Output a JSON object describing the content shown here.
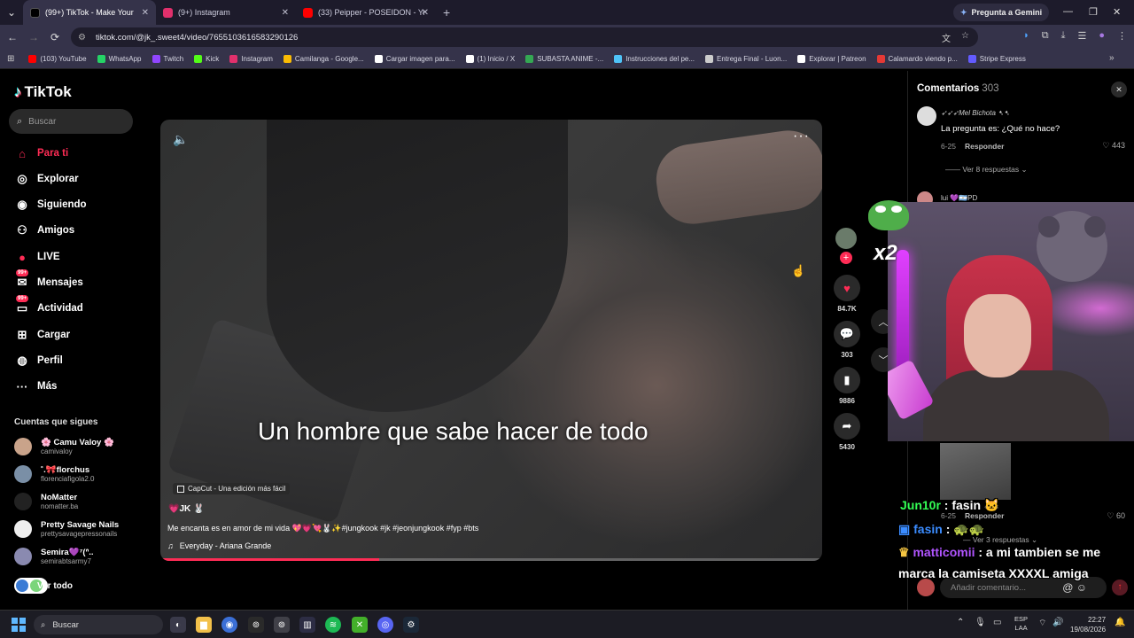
{
  "browser": {
    "tabs": [
      {
        "title": "(99+) TikTok - Make Your Day",
        "active": true,
        "favicon_color": "#000000"
      },
      {
        "title": "(9+) Instagram",
        "active": false,
        "favicon_color": "#e1306c"
      },
      {
        "title": "(33) Peipper - POSEIDON - YouTube",
        "active": false,
        "favicon_color": "#ff0000"
      }
    ],
    "gemini_label": "Pregunta a Gemini",
    "url": "tiktok.com/@jk_.sweet4/video/7655103616583290126",
    "bookmarks": [
      {
        "label": "(103) YouTube",
        "color": "#ff0000"
      },
      {
        "label": "WhatsApp",
        "color": "#25d366"
      },
      {
        "label": "Twitch",
        "color": "#9146ff"
      },
      {
        "label": "Kick",
        "color": "#53fc18"
      },
      {
        "label": "Instagram",
        "color": "#e1306c"
      },
      {
        "label": "Camilanga - Google...",
        "color": "#fbbc04"
      },
      {
        "label": "Cargar imagen para...",
        "color": "#ffffff"
      },
      {
        "label": "(1) Inicio / X",
        "color": "#ffffff"
      },
      {
        "label": "SUBASTA ANIME -...",
        "color": "#34a853"
      },
      {
        "label": "Instrucciones del pe...",
        "color": "#4fc3f7"
      },
      {
        "label": "Entrega Final - Luon...",
        "color": "#cccccc"
      },
      {
        "label": "Explorar | Patreon",
        "color": "#ffffff"
      },
      {
        "label": "Calamardo viendo p...",
        "color": "#e53935"
      },
      {
        "label": "Stripe Express",
        "color": "#635bff"
      }
    ]
  },
  "tiktok": {
    "logo_text": "TikTok",
    "search_placeholder": "Buscar",
    "nav": [
      {
        "label": "Para ti",
        "icon": "home-icon",
        "active": true
      },
      {
        "label": "Explorar",
        "icon": "compass-icon",
        "active": false
      },
      {
        "label": "Siguiendo",
        "icon": "following-icon",
        "active": false
      },
      {
        "label": "Amigos",
        "icon": "friends-icon",
        "active": false
      },
      {
        "label": "LIVE",
        "icon": "live-icon",
        "active": false
      },
      {
        "label": "Mensajes",
        "icon": "messages-icon",
        "active": false,
        "badge": "99+"
      },
      {
        "label": "Actividad",
        "icon": "activity-icon",
        "active": false,
        "badge": "99+"
      },
      {
        "label": "Cargar",
        "icon": "upload-icon",
        "active": false
      },
      {
        "label": "Perfil",
        "icon": "profile-icon",
        "active": false
      },
      {
        "label": "Más",
        "icon": "more-icon",
        "active": false
      }
    ],
    "following_header": "Cuentas que sigues",
    "following": [
      {
        "name": "🌸 Camu Valoy 🌸",
        "handle": "camivaloy",
        "color": "#c9a38a"
      },
      {
        "name": "˚.🎀florchus",
        "handle": "florenciafigola2.0",
        "color": "#7a8fa6"
      },
      {
        "name": "NoMatter",
        "handle": "nomatter.ba",
        "color": "#222222"
      },
      {
        "name": "Pretty Savage Nails",
        "handle": "prettysavagepressonails",
        "color": "#eeeeee"
      },
      {
        "name": "Semira💜⁷(ᐢ..",
        "handle": "semirabtsarmy7",
        "color": "#8a8ab0"
      }
    ],
    "see_all": "Ver todo"
  },
  "video": {
    "overlay_caption": "Un hombre que sabe hacer de todo",
    "capcut_label": "CapCut - Una edición más fácil",
    "author": "💗JK 🐰",
    "description": "Me encanta es en amor de mi vida 💖💗💘🐰✨#jungkook #jk #jeonjungkook #fyp #bts",
    "music": "Everyday - Ariana Grande",
    "progress": 0.33
  },
  "actions": {
    "likes": "84.7K",
    "comments": "303",
    "saves": "9886",
    "shares": "5430"
  },
  "comments_panel": {
    "title": "Comentarios",
    "count": "303",
    "items": [
      {
        "user": "➶➶➶Mel Bichota ➷➷",
        "text": "La pregunta es: ¿Qué no hace?",
        "date": "6-25",
        "reply": "Responder",
        "likes": "443",
        "more": "Ver 8 respuestas"
      },
      {
        "user": "lui 💜🇦🇷PD",
        "text": "",
        "date": "",
        "reply": "",
        "likes": "",
        "more": ""
      },
      {
        "user": "",
        "text": "",
        "date": "6-25",
        "reply": "Responder",
        "likes": "60",
        "more": "Ver 3 respuestas"
      }
    ],
    "add_placeholder": "Añadir comentario..."
  },
  "stream_chat": [
    {
      "user": "Jun10r",
      "message": " : fasin 🐱"
    },
    {
      "user": "fasin",
      "message": " : 🐢🐢"
    },
    {
      "user": "matticomii",
      "message": " : a mi tambien se me"
    },
    {
      "user": "",
      "message": "marca la camiseta XXXXL amiga"
    }
  ],
  "overlay": {
    "multiplier": "x2"
  },
  "taskbar": {
    "search_placeholder": "Buscar",
    "lang_top": "ESP",
    "lang_bottom": "LAA",
    "time": "22:27",
    "date": "19/08/2026"
  }
}
